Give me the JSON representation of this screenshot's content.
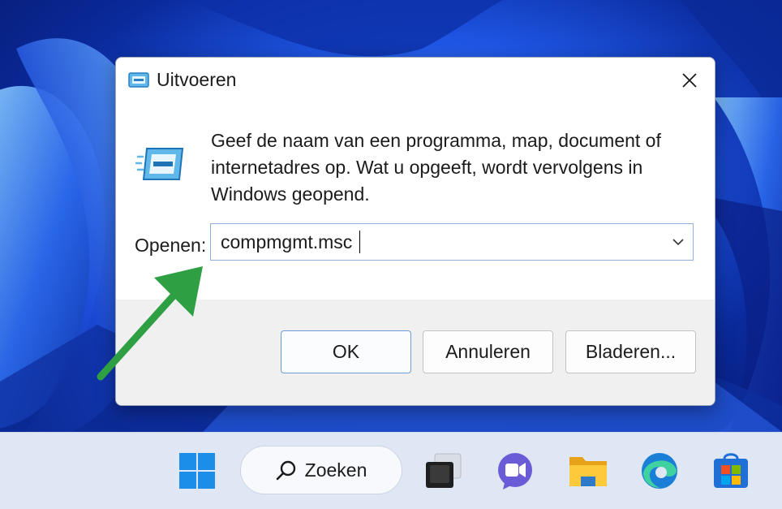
{
  "dialog": {
    "title": "Uitvoeren",
    "description": "Geef de naam van een programma, map, document of internetadres op. Wat u opgeeft, wordt vervolgens in Windows geopend.",
    "open_label": "Openen:",
    "input_value": "compmgmt.msc",
    "buttons": {
      "ok": "OK",
      "cancel": "Annuleren",
      "browse": "Bladeren..."
    },
    "icons": {
      "app": "run-icon",
      "close": "close-icon",
      "dropdown": "chevron-down-icon"
    }
  },
  "taskbar": {
    "search_label": "Zoeken",
    "items": [
      "start-icon",
      "search-icon",
      "task-view-icon",
      "chat-icon",
      "file-explorer-icon",
      "edge-icon",
      "store-icon"
    ]
  },
  "annotation": {
    "arrow_color": "#2ea043"
  },
  "colors": {
    "accent": "#1f57e6",
    "focus_border": "#8fb0da"
  }
}
